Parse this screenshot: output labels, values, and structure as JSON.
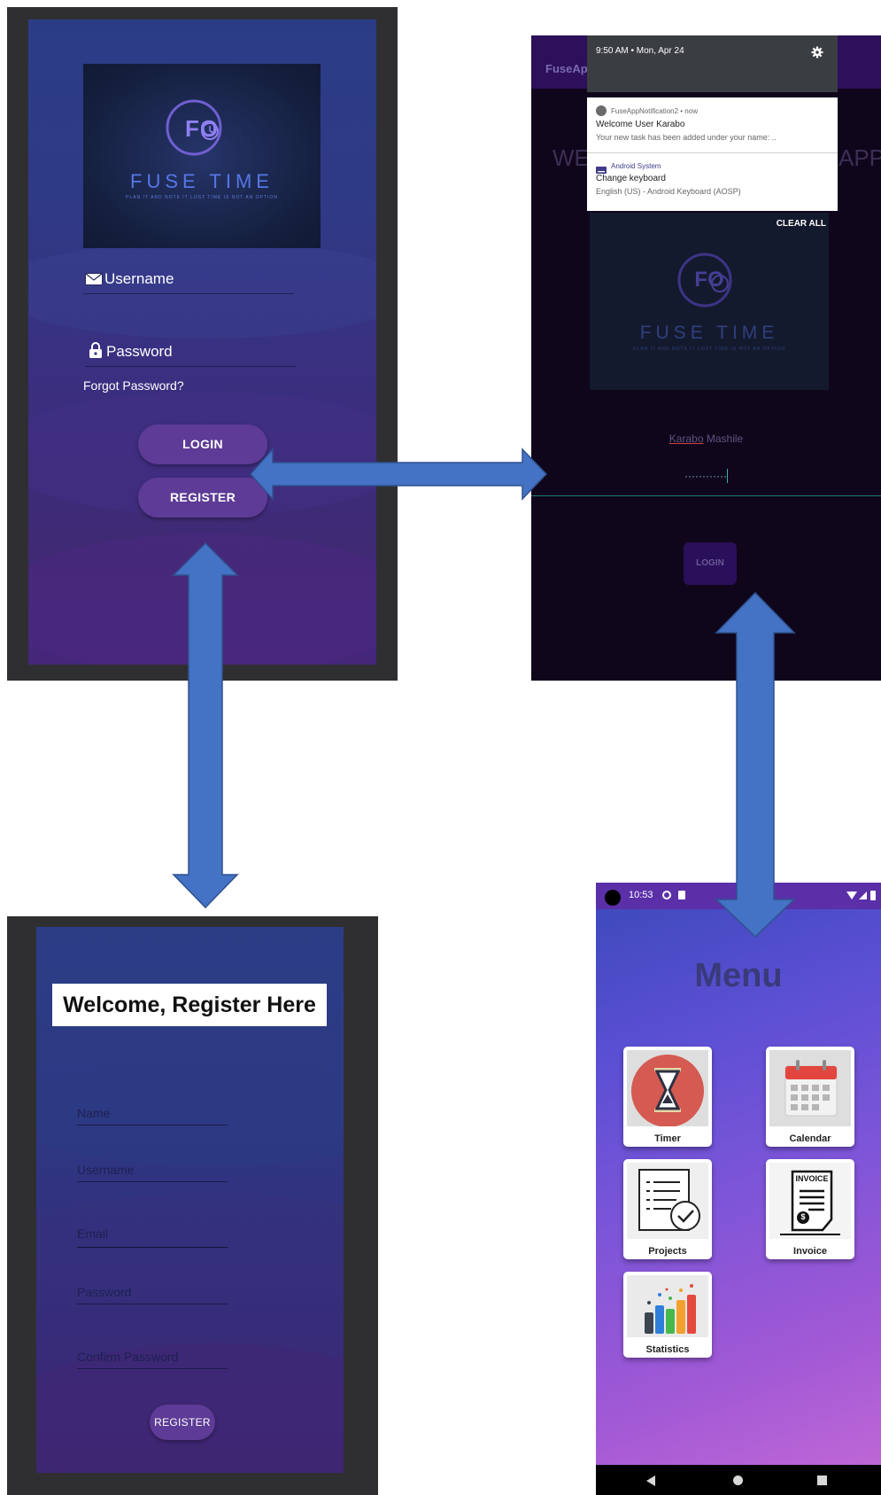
{
  "login": {
    "logo_mark": "FO",
    "logo_title": "FUSE TIME",
    "logo_tagline": "PLAN IT AND NOTE IT LOST TIME IS NOT AN OPTION",
    "username_label": "Username",
    "password_label": "Password",
    "forgot_password": "Forgot Password?",
    "login_button": "LOGIN",
    "register_button": "REGISTER"
  },
  "dark_login": {
    "appbar_title_partial": "FuseAp",
    "welcome_left": "WE",
    "welcome_right": "APP",
    "notification": {
      "datetime": "9:50 AM • Mon, Apr 24",
      "app_name": "FuseAppNotification2 • now",
      "title": "Welcome User Karabo",
      "body": "Your new task has been added under your name: ..",
      "system_app": "Android System",
      "system_title": "Change keyboard",
      "system_body": "English (US) - Android Keyboard (AOSP)",
      "clear_all": "CLEAR ALL"
    },
    "logo_mark": "FO",
    "logo_title": "FUSE TIME",
    "logo_tagline": "PLAN IT AND NOTE IT LOST TIME IS NOT AN OPTION",
    "username_first": "Karabo",
    "username_last": "Mashile",
    "password_mask": "············",
    "login_button": "LOGIN"
  },
  "register": {
    "title": "Welcome, Register Here",
    "name_placeholder": "Name",
    "username_placeholder": "Username",
    "email_placeholder": "Email",
    "password_placeholder": "Password",
    "confirm_password_placeholder": "Confirm Password",
    "register_button": "REGISTER"
  },
  "menu": {
    "status_time": "10:53",
    "title": "Menu",
    "tiles": [
      {
        "label": "Timer",
        "icon": "hourglass-icon"
      },
      {
        "label": "Calendar",
        "icon": "calendar-icon"
      },
      {
        "label": "Projects",
        "icon": "checklist-icon"
      },
      {
        "label": "Invoice",
        "icon": "invoice-icon"
      },
      {
        "label": "Statistics",
        "icon": "bar-chart-icon"
      }
    ],
    "invoice_word": "INVOICE",
    "invoice_symbol": "$"
  },
  "colors": {
    "arrow_fill": "#4472c4",
    "arrow_stroke": "#2f528f",
    "button_purple": "#5d3b96",
    "menu_title": "#3a3a7a"
  }
}
